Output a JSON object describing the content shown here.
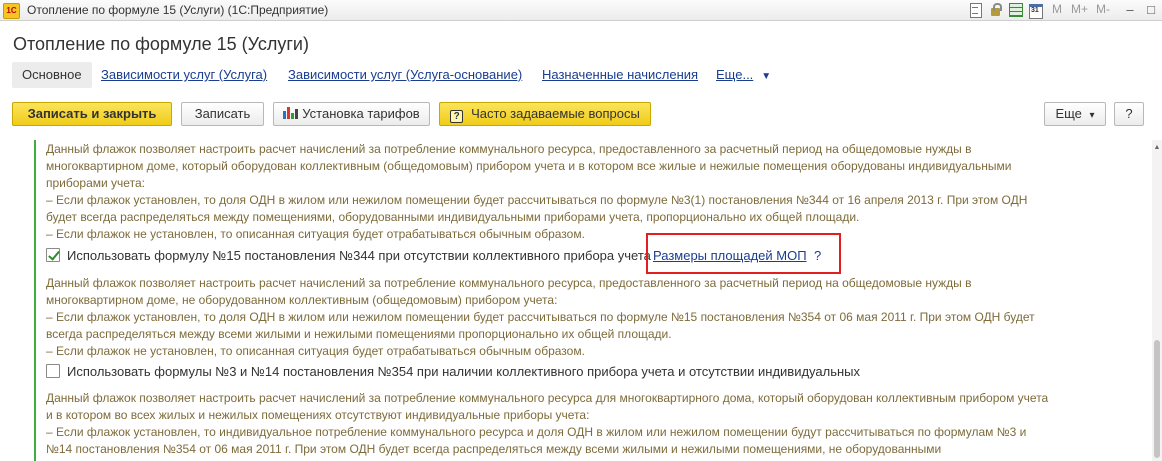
{
  "window": {
    "app_logo": "1С",
    "title": "Отопление по формуле 15 (Услуги)  (1С:Предприятие)",
    "memory_buttons": [
      "M",
      "M+",
      "M-"
    ],
    "toolbar_icons": [
      "document-icon",
      "lock-icon",
      "spreadsheet-icon",
      "calendar-icon"
    ],
    "controls": {
      "minimize": "–",
      "maximize": "□",
      "close": "×"
    }
  },
  "form": {
    "title": "Отопление по формуле 15 (Услуги)",
    "nav": {
      "tabs": [
        {
          "label": "Основное",
          "active": true
        },
        {
          "label": "Зависимости услуг (Услуга)",
          "active": false
        },
        {
          "label": "Зависимости услуг (Услуга-основание)",
          "active": false
        },
        {
          "label": "Назначенные начисления",
          "active": false
        }
      ],
      "more_label": "Еще...",
      "more_arrow": "▼"
    },
    "toolbar": {
      "save_close": "Записать и закрыть",
      "save": "Записать",
      "tariffs": "Установка тарифов",
      "faq": "Часто задаваемые вопросы",
      "faq_icon_glyph": "?",
      "more": "Еще",
      "more_arrow": "▾",
      "help": "?"
    }
  },
  "content": {
    "block1_desc": "Данный флажок позволяет настроить расчет начислений за потребление коммунального ресурса, предоставленного за расчетный период на общедомовые нужды в\nмногоквартирном доме, который оборудован коллективным (общедомовым) прибором учета и в котором все жилые и нежилые помещения оборудованы индивидуальными\nприборами учета:\n– Если флажок установлен, то доля ОДН в жилом или нежилом помещении будет рассчитываться по формуле №3(1) постановления №344 от 16 апреля 2013 г. При этом ОДН\nбудет всегда распределяться между помещениями, оборудованными индивидуальными приборами учета, пропорционально их общей площади.\n– Если флажок не установлен, то описанная ситуация будет отрабатываться обычным образом.",
    "checkbox1": {
      "label": "Использовать формулу №15 постановления №344 при отсутствии коллективного прибора учета",
      "checked": true
    },
    "mop_link": "Размеры площадей МОП",
    "mop_help": "?",
    "block2_desc": "Данный флажок позволяет настроить расчет начислений за потребление коммунального ресурса, предоставленного за расчетный период на общедомовые нужды в\nмногоквартирном доме, не оборудованном коллективным (общедомовым) прибором учета:\n– Если флажок установлен, то доля ОДН в жилом или нежилом помещении будет рассчитываться по формуле №15 постановления №354 от 06 мая 2011 г. При этом ОДН будет\nвсегда распределяться между всеми жилыми и нежилыми помещениями пропорционально их общей площади.\n– Если флажок не установлен, то описанная ситуация будет отрабатываться обычным образом.",
    "checkbox2": {
      "label": "Использовать формулы №3 и №14 постановления №354 при наличии коллективного прибора учета и отсутствии индивидуальных",
      "checked": false
    },
    "block3_desc": "Данный флажок позволяет настроить расчет начислений за потребление коммунального ресурса для многоквартирного дома, который оборудован коллективным прибором учета\nи в котором во всех жилых и нежилых помещениях отсутствуют индивидуальные приборы учета:\n– Если флажок установлен, то индивидуальное потребление коммунального ресурса и доля ОДН в жилом или нежилом помещении будут рассчитываться по формулам №3 и\n№14 постановления №354 от 06 мая 2011 г. При этом ОДН будет всегда распределяться между всеми жилыми и нежилыми помещениями, не оборудованными"
  },
  "colors": {
    "primary_button": "#f0cc18",
    "link": "#1a3d8f",
    "description_text": "#7d6b3a",
    "group_bar": "#3fae3f",
    "highlight": "#e01f1f"
  }
}
